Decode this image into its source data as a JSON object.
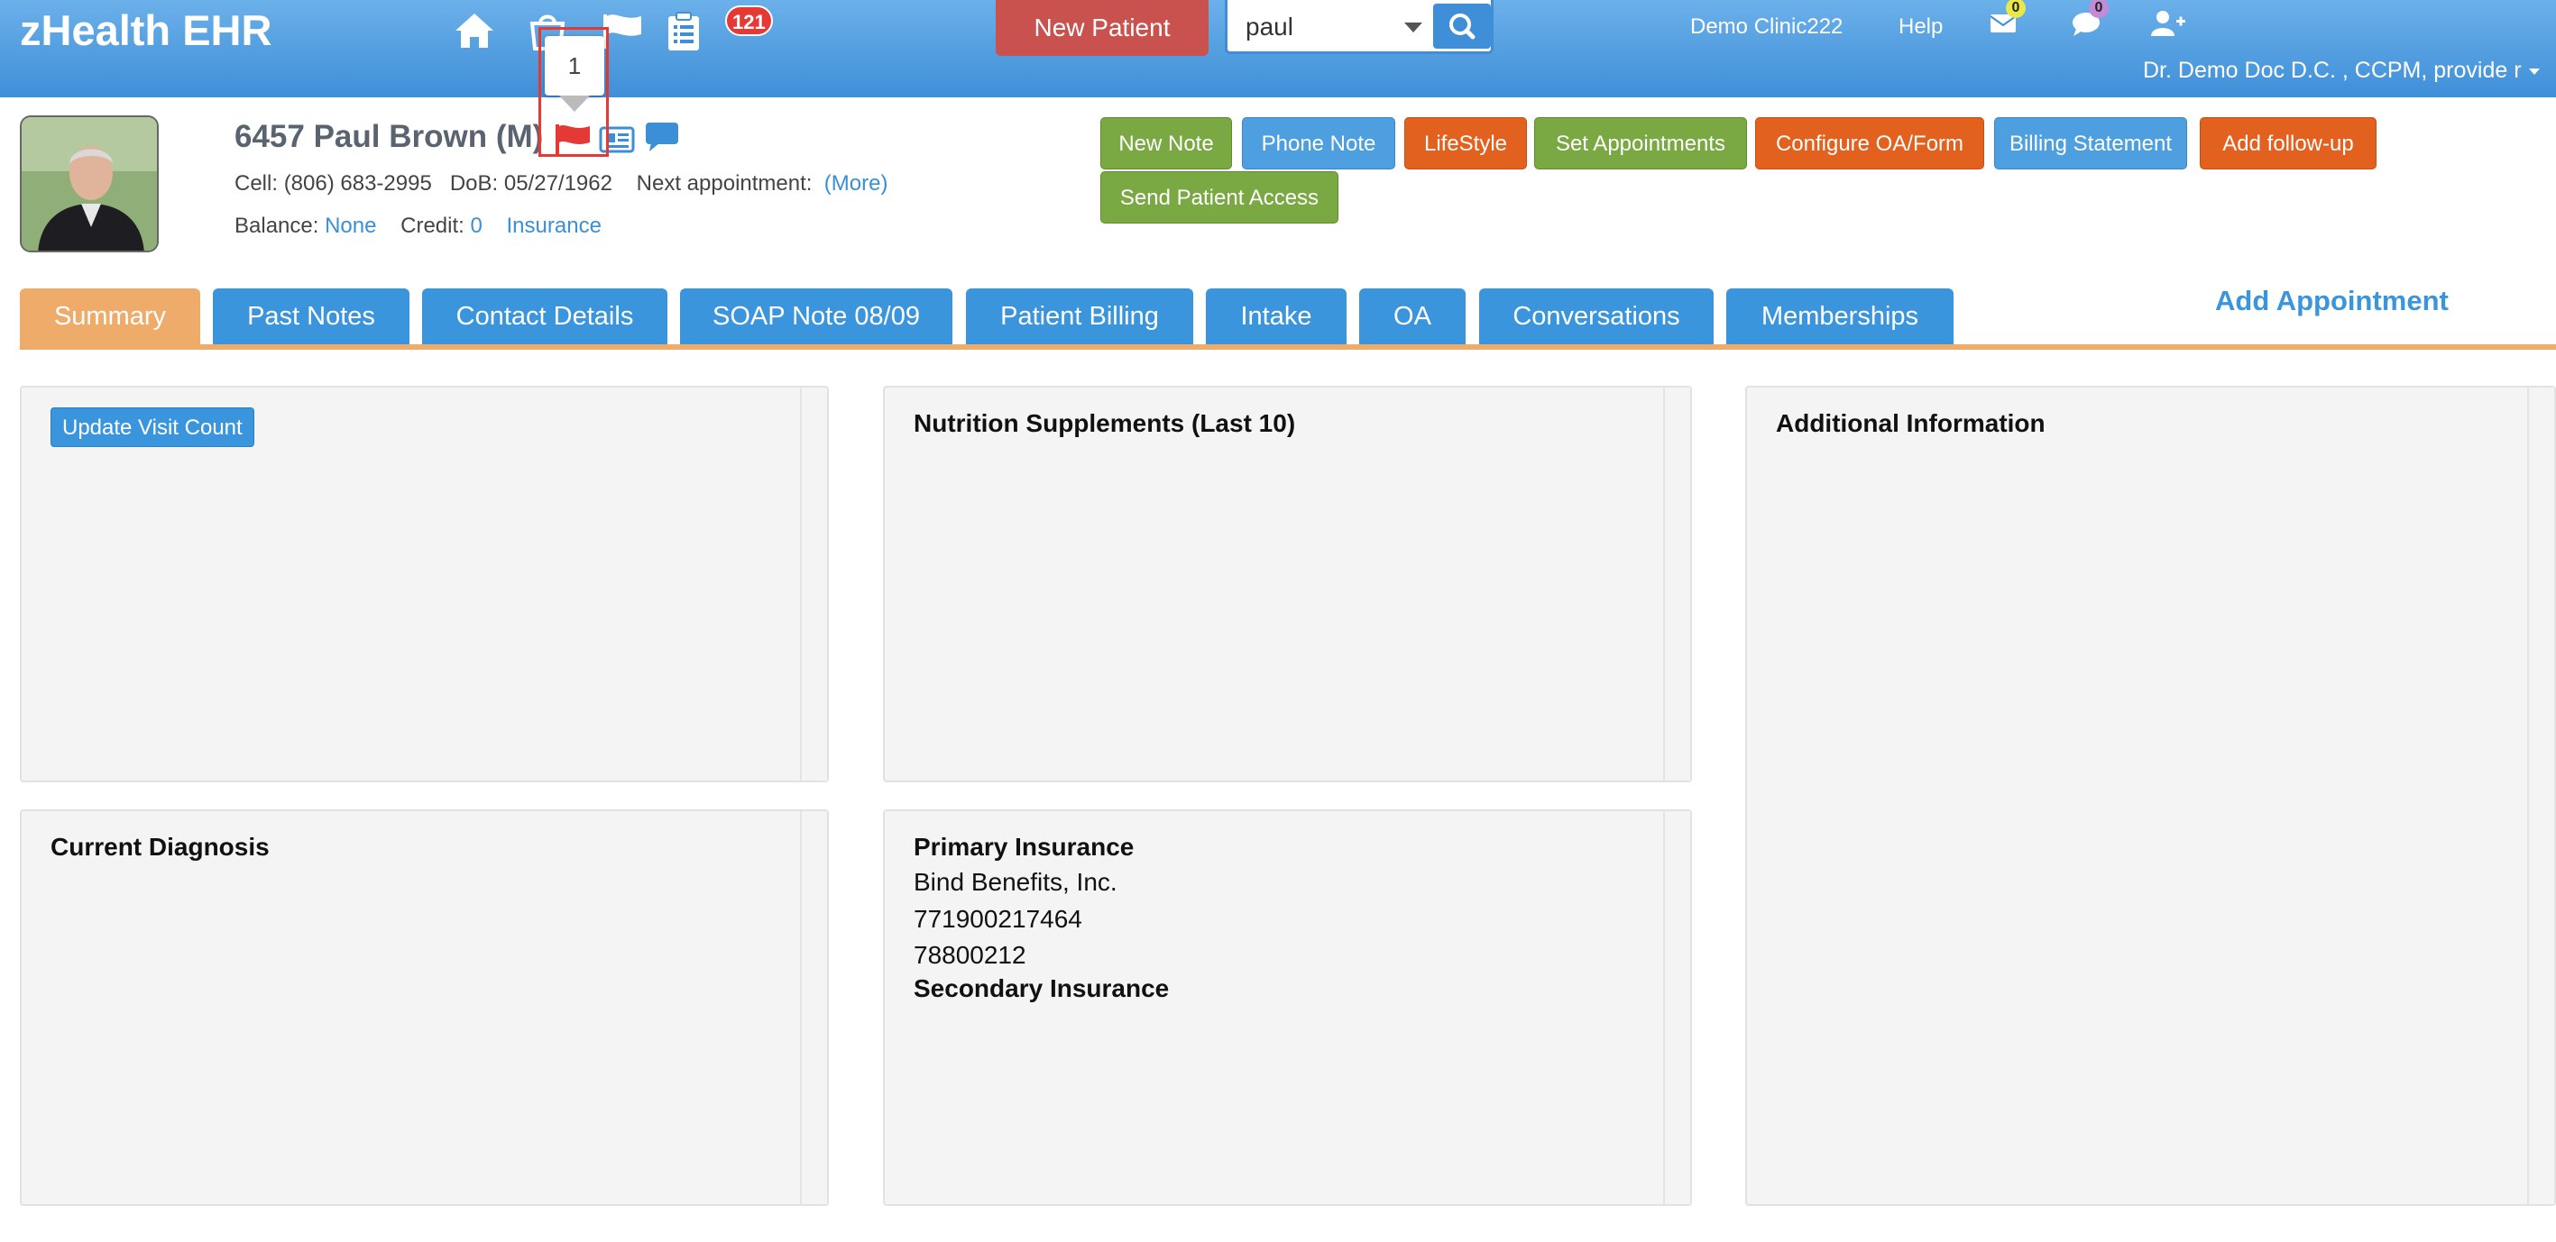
{
  "app": {
    "title": "zHealth EHR",
    "notification_count": "121",
    "new_patient_label": "New Patient",
    "search_value": "paul",
    "clinic": "Demo Clinic222",
    "help": "Help",
    "mail_count": "0",
    "chat_count": "0",
    "user": "Dr. Demo Doc D.C. , CCPM, provide r"
  },
  "patient": {
    "name": "6457 Paul Brown (M)",
    "cell_label": "Cell:",
    "cell": "(806) 683-2995",
    "dob_label": "DoB:",
    "dob": "05/27/1962",
    "next_appt_label": "Next appointment:",
    "more": "(More)",
    "balance_label": "Balance:",
    "balance": "None",
    "credit_label": "Credit:",
    "credit": "0",
    "insurance_link": "Insurance",
    "flag_tooltip": "1"
  },
  "actions": [
    {
      "label": "New Note",
      "color": "green"
    },
    {
      "label": "Phone Note",
      "color": "blue"
    },
    {
      "label": "LifeStyle",
      "color": "orange"
    },
    {
      "label": "Set Appointments",
      "color": "green"
    },
    {
      "label": "Configure OA/Form",
      "color": "orange"
    },
    {
      "label": "Billing Statement",
      "color": "blue"
    },
    {
      "label": "Add follow-up",
      "color": "orange"
    },
    {
      "label": "Send Patient Access",
      "color": "green"
    }
  ],
  "tabs": [
    {
      "label": "Summary",
      "active": true
    },
    {
      "label": "Past Notes"
    },
    {
      "label": "Contact Details"
    },
    {
      "label": "SOAP Note 08/09"
    },
    {
      "label": "Patient Billing"
    },
    {
      "label": "Intake"
    },
    {
      "label": "OA"
    },
    {
      "label": "Conversations"
    },
    {
      "label": "Memberships"
    }
  ],
  "add_appointment": "Add Appointment",
  "panels": {
    "update_visit_count": "Update Visit Count",
    "nutrition_title": "Nutrition Supplements (Last 10)",
    "additional_title": "Additional Information",
    "diagnosis_title": "Current Diagnosis",
    "primary_ins_title": "Primary Insurance",
    "primary_ins_company": "Bind Benefits, Inc.",
    "primary_ins_id": "771900217464",
    "primary_ins_group": "78800212",
    "secondary_ins_title": "Secondary Insurance"
  },
  "colors": {
    "topbar": "#3f8fd8",
    "active_tab": "#efab69",
    "tab": "#3a95dd",
    "green_btn": "#7aa842",
    "blue_btn": "#4d9fe0",
    "orange_btn": "#e2611f",
    "new_patient_btn": "#c9524f"
  }
}
